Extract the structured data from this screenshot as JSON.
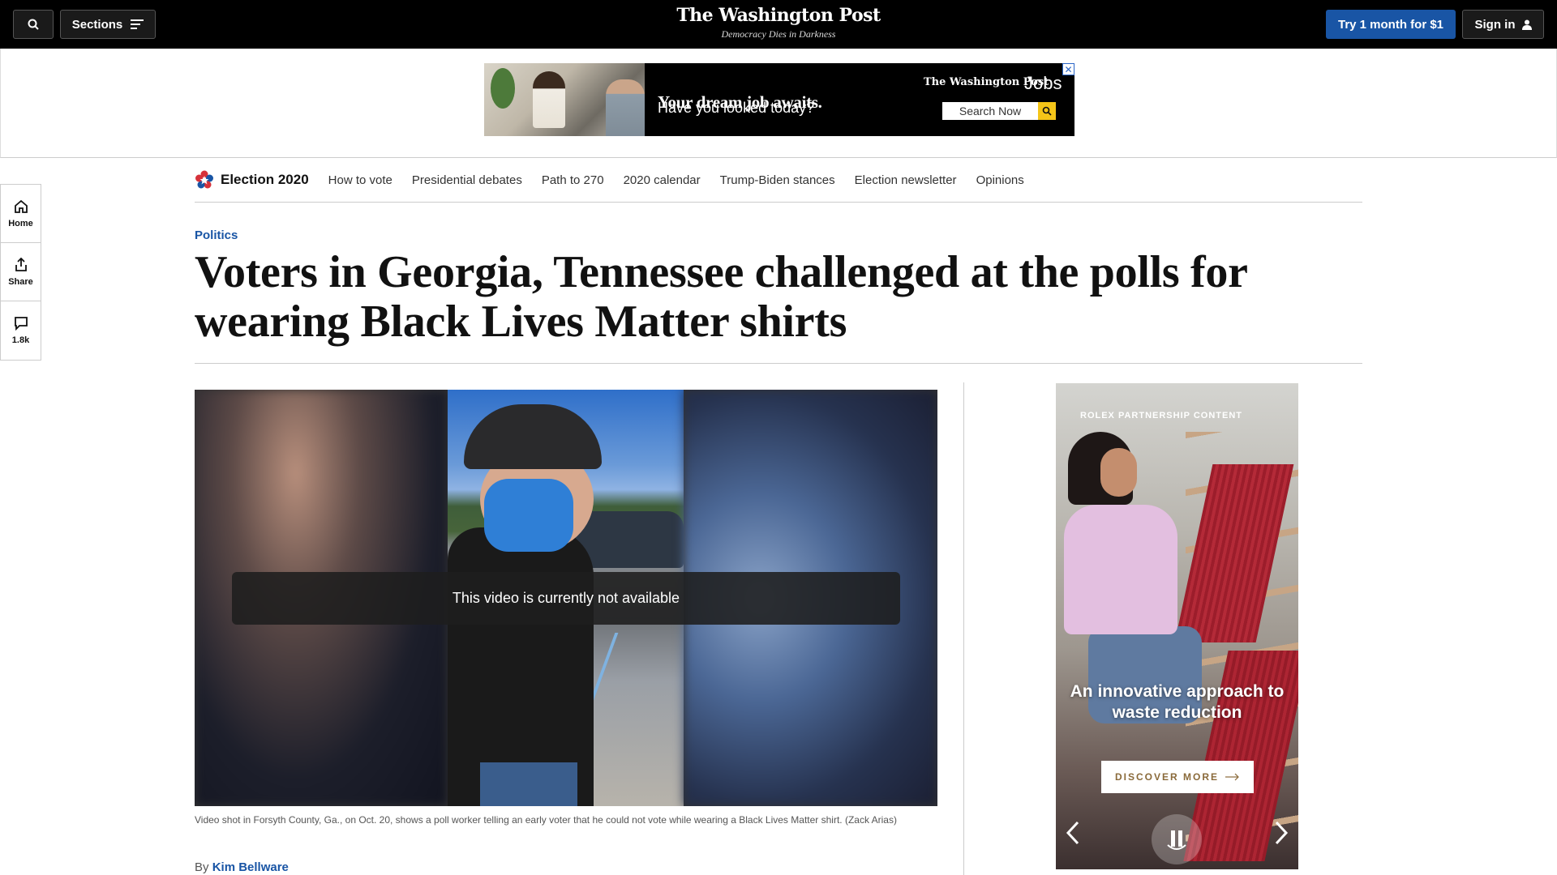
{
  "header": {
    "sections_label": "Sections",
    "logo": "The Washington Post",
    "tagline": "Democracy Dies in Darkness",
    "subscribe_label": "Try 1 month for $1",
    "signin_label": "Sign in"
  },
  "banner_ad": {
    "headline": "Your dream job awaits.",
    "subline": "Have you looked today?",
    "brand": "The Washington Post",
    "brand_suffix": "Jobs",
    "search_label": "Search Now"
  },
  "left_rail": {
    "home": "Home",
    "share": "Share",
    "comments": "1.8k"
  },
  "election_nav": {
    "title": "Election 2020",
    "links": [
      "How to vote",
      "Presidential debates",
      "Path to 270",
      "2020 calendar",
      "Trump-Biden stances",
      "Election newsletter",
      "Opinions"
    ]
  },
  "article": {
    "kicker": "Politics",
    "headline": "Voters in Georgia, Tennessee challenged at the polls for wearing Black Lives Matter shirts",
    "video_notice": "This video is currently not available",
    "caption": "Video shot in Forsyth County, Ga., on Oct. 20, shows a poll worker telling an early voter that he could not vote while wearing a Black Lives Matter shirt. (Zack Arias)",
    "byline_prefix": "By",
    "author": "Kim Bellware"
  },
  "side_ad": {
    "label": "ROLEX PARTNERSHIP CONTENT",
    "tagline": "An innovative approach to waste reduction",
    "cta": "DISCOVER MORE"
  },
  "colors": {
    "accent_blue": "#1955a5",
    "topbar": "#000000"
  }
}
